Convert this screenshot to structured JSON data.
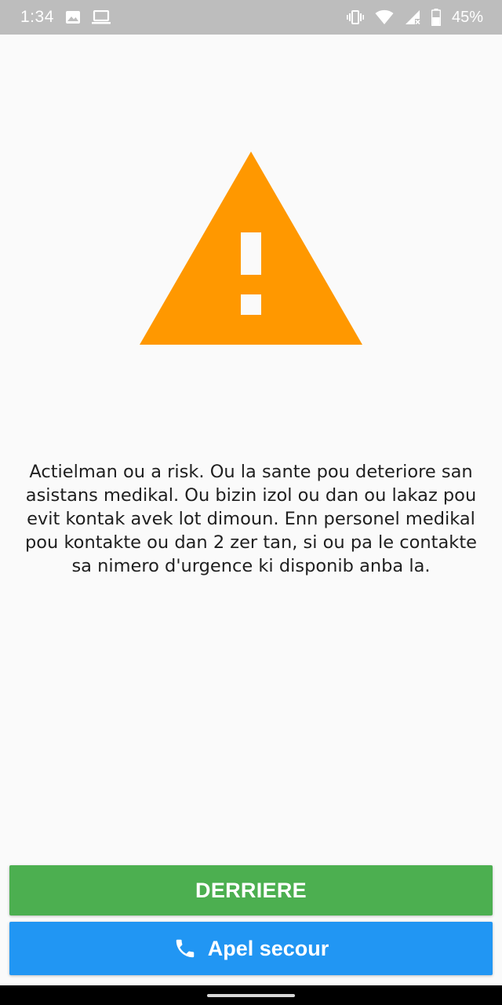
{
  "status_bar": {
    "time": "1:34",
    "battery_percent": "45%",
    "left_icons": [
      "image-icon",
      "laptop-icon"
    ],
    "right_icons": [
      "vibrate-icon",
      "wifi-icon",
      "signal-icon",
      "battery-icon"
    ]
  },
  "warning": {
    "icon": "warning-triangle-icon",
    "color": "#ff9800"
  },
  "message": {
    "text": "Actielman ou a risk. Ou la sante pou deteriore san asistans medikal. Ou bizin izol ou dan ou lakaz pou evit kontak avek lot dimoun. Enn personel medikal pou kontakte ou dan 2 zer tan, si ou pa le contakte sa nimero d'urgence ki disponib anba la."
  },
  "buttons": {
    "back_label": "DERRIERE",
    "back_color": "#4caf50",
    "call_label": "Apel secour",
    "call_icon": "phone-icon",
    "call_color": "#2196f3"
  }
}
